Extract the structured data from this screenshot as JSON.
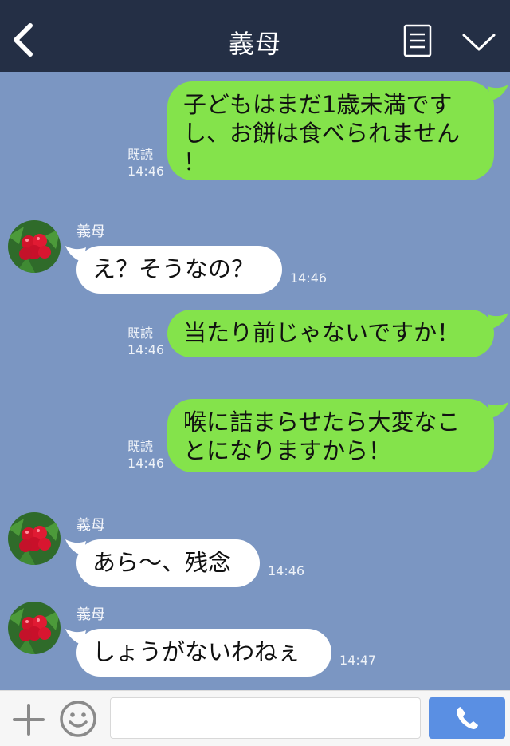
{
  "header": {
    "title": "義母"
  },
  "messages": [
    {
      "direction": "out",
      "text": "子どもはまだ1歳未満です\nし、お餅は食べられません\n！",
      "read": "既読",
      "time": "14:46"
    },
    {
      "direction": "in",
      "sender": "義母",
      "text": "え？そうなの？",
      "time": "14:46"
    },
    {
      "direction": "out",
      "text": "当たり前じゃないですか！",
      "read": "既読",
      "time": "14:46"
    },
    {
      "direction": "out",
      "text": "喉に詰まらせたら大変なこ\nとになりますから！",
      "read": "既読",
      "time": "14:46"
    },
    {
      "direction": "in",
      "sender": "義母",
      "text": "あら〜、残念",
      "time": "14:46"
    },
    {
      "direction": "in",
      "sender": "義母",
      "text": "しょうがないわねぇ",
      "time": "14:47"
    }
  ],
  "input": {
    "value": "",
    "placeholder": ""
  },
  "colors": {
    "header_bg": "#242f45",
    "chat_bg": "#7b96c2",
    "outgoing_bubble": "#84e34b",
    "incoming_bubble": "#ffffff",
    "call_button": "#5a8fe3"
  },
  "icons": {
    "back": "chevron-left-icon",
    "menu": "list-icon",
    "collapse": "chevron-down-icon",
    "add": "plus-icon",
    "emoji": "smiley-icon",
    "call": "phone-icon",
    "avatar": "red-berries-photo"
  }
}
